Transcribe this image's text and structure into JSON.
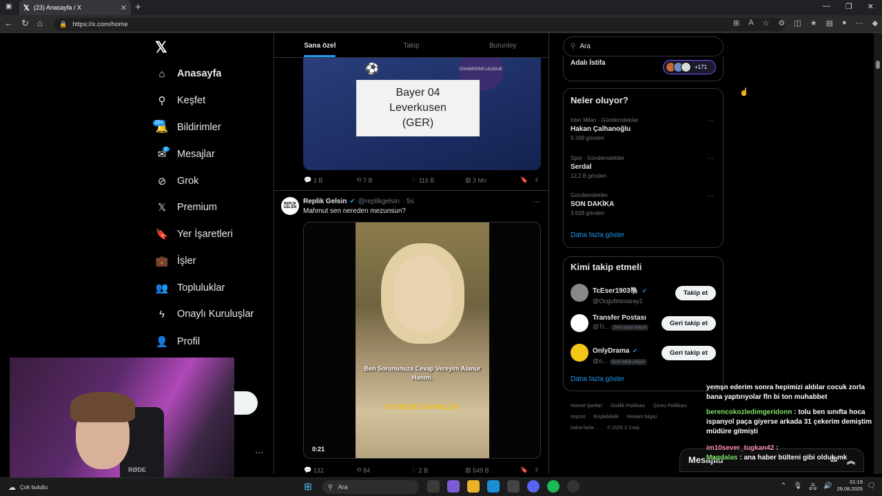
{
  "browser": {
    "tab_title": "(23) Anasayfa / X",
    "url": "https://x.com/home"
  },
  "sidebar": {
    "items": [
      {
        "label": "Anasayfa",
        "icon": "home-icon"
      },
      {
        "label": "Keşfet",
        "icon": "search-icon"
      },
      {
        "label": "Bildirimler",
        "icon": "bell-icon",
        "badge": "20+"
      },
      {
        "label": "Mesajlar",
        "icon": "mail-icon",
        "badge": "2"
      },
      {
        "label": "Grok",
        "icon": "grok-icon"
      },
      {
        "label": "Premium",
        "icon": "x-icon"
      },
      {
        "label": "Yer İşaretleri",
        "icon": "bookmark-icon"
      },
      {
        "label": "İşler",
        "icon": "briefcase-icon"
      },
      {
        "label": "Topluluklar",
        "icon": "people-icon"
      },
      {
        "label": "Onaylı Kuruluşlar",
        "icon": "lightning-icon"
      },
      {
        "label": "Profil",
        "icon": "person-icon"
      }
    ]
  },
  "feed": {
    "tabs": [
      "Sana özel",
      "Takip",
      "Burunley"
    ],
    "tweet1": {
      "image_text": [
        "Bayer 04",
        "Leverkusen",
        "(GER)"
      ],
      "badge_text": "CHAMPIONS LEAGUE",
      "replies": "1 B",
      "reposts": "7 B",
      "likes": "116 B",
      "views": "3 Mn"
    },
    "tweet2": {
      "name": "Replik Gelsin",
      "handle": "@replikgelsin",
      "time": "· 5s",
      "avatar_text": "REPLİK GELSİN",
      "text": "Mahmut sen nereden mezunsun?",
      "subtitle": "Ben Sorununuza Cevap Vereyim Alanur Hanım.",
      "watermark": "EXTREME SAHNELER",
      "duration": "0:21",
      "replies": "132",
      "reposts": "84",
      "likes": "2 B",
      "views": "549 B"
    }
  },
  "right": {
    "search_value": "Ara",
    "top_title": "Adalı İstifa",
    "pill_count": "+171",
    "trends_title": "Neler oluyor?",
    "trends": [
      {
        "category": "Inter Milan · Gündemdekiler",
        "name": "Hakan Çalhanoğlu",
        "count": "9.349 gönderi"
      },
      {
        "category": "Spor · Gündemdekiler",
        "name": "Serdal",
        "count": "12,2 B gönderi"
      },
      {
        "category": "Gündemdekiler",
        "name": "SON DAKİKA",
        "count": "3.628 gönderi"
      }
    ],
    "show_more": "Daha fazla göster",
    "who_title": "Kimi takip etmeli",
    "accounts": [
      {
        "name": "TcEser1903🐘",
        "handle": "@Ocgufetosaray1",
        "button": "Takip et",
        "follows_you": ""
      },
      {
        "name": "Transfer Postası",
        "handle": "@Tr...",
        "button": "Geri takip et",
        "follows_you": "Seni takip ediyor"
      },
      {
        "name": "OnlyDrama",
        "handle": "@o...",
        "button": "Geri takip et",
        "follows_you": "Seni takip ediyor"
      }
    ],
    "footer": [
      "Hizmet Şartları",
      "Gizlilik Politikası",
      "Çerez Politikası",
      "Imprint",
      "Erişilebilirlik",
      "Reklam bilgisi",
      "Daha fazla ...",
      "© 2025 X Corp."
    ]
  },
  "chat": {
    "line1": "yemşn ederim sonra hepimizi aldılar cocuk zorla bana yaptırıyolar fln bi ton muhabbet",
    "user2": "berencokozledimgeridonn",
    "msg2": ": tolu ben sınıfta hoca ispanyol paça giyerse arkada 31 çekerim demiştim müdüre gitmişti",
    "user3": "im10sever_tugkan42",
    "msg3": ":",
    "user4": "Magdalas",
    "msg4": ": ana haber bülteni gibi olduk mk"
  },
  "messages_bar": {
    "label": "Mesajlar"
  },
  "taskbar": {
    "weather": "Çok bulutlu",
    "search": "Ara",
    "time": "01:19",
    "date": "29.08.2025"
  },
  "colors": {
    "accent": "#1d9bf0",
    "background": "#000000",
    "border": "#2f3336"
  }
}
